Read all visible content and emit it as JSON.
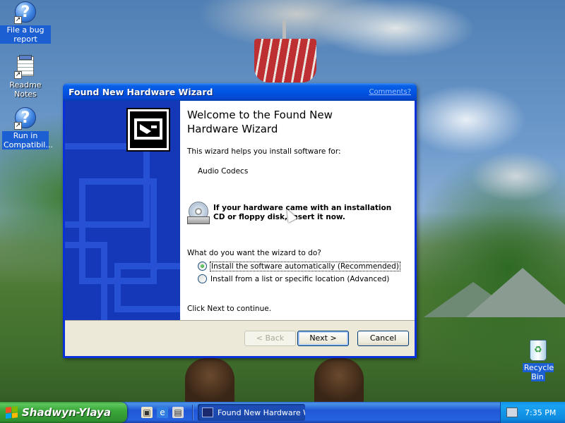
{
  "desktop": {
    "icons": [
      {
        "label": "File a bug report",
        "icon": "help-icon"
      },
      {
        "label": "Readme Notes",
        "icon": "notepad-icon"
      },
      {
        "label": "Run in Compatibil...",
        "icon": "help-icon"
      }
    ],
    "recycle_bin": {
      "label": "Recycle Bin",
      "icon": "recycle-bin-icon"
    }
  },
  "window": {
    "title": "Found New Hardware Wizard",
    "comments_link": "Comments?",
    "heading": "Welcome to the Found New Hardware Wizard",
    "intro": "This wizard helps you install software for:",
    "device_name": "Audio Codecs",
    "cd_prompt": "If your hardware came with an installation CD or floppy disk, insert it now.",
    "question": "What do you want the wizard to do?",
    "options": [
      {
        "label": "Install the software automatically (Recommended)",
        "checked": true
      },
      {
        "label": "Install from a list or specific location (Advanced)",
        "checked": false
      }
    ],
    "next_hint": "Click Next to continue.",
    "buttons": {
      "back": "< Back",
      "next": "Next >",
      "cancel": "Cancel"
    }
  },
  "taskbar": {
    "start_label": "Shadwyn-Ylaya",
    "task_button": "Found New Hardware W...",
    "clock": "7:35 PM"
  },
  "colors": {
    "title_blue": "#0054e3",
    "start_green": "#3ba83b",
    "side_panel_blue": "#1438b8"
  }
}
